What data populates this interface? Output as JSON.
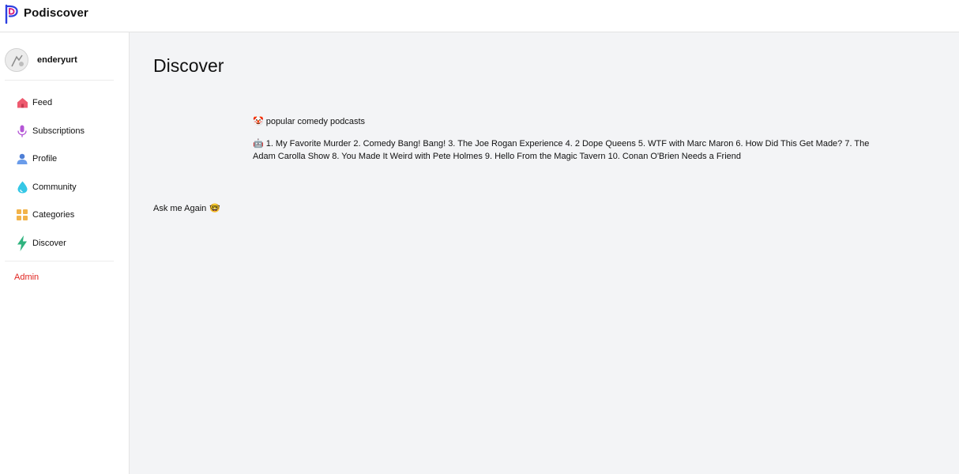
{
  "app": {
    "brand": "Podiscover",
    "colors": {
      "brand_blue": "#2c3fe0",
      "brand_magenta": "#d81b7a",
      "admin_red": "#e0241f",
      "main_bg": "#f3f4f6"
    }
  },
  "user": {
    "username": "enderyurt",
    "avatar_icon": "user-avatar"
  },
  "sidebar": {
    "items": [
      {
        "label": "Feed",
        "icon": "home-icon"
      },
      {
        "label": "Subscriptions",
        "icon": "microphone-icon"
      },
      {
        "label": "Profile",
        "icon": "person-icon"
      },
      {
        "label": "Community",
        "icon": "droplet-icon"
      },
      {
        "label": "Categories",
        "icon": "grid-icon"
      },
      {
        "label": "Discover",
        "icon": "lightning-icon"
      }
    ],
    "admin_label": "Admin"
  },
  "main": {
    "title": "Discover",
    "prompt_emoji": "🤡",
    "prompt_text": "popular comedy podcasts",
    "answer_emoji": "🤖",
    "answer_text": "1. My Favorite Murder 2. Comedy Bang! Bang! 3. The Joe Rogan Experience 4. 2 Dope Queens 5. WTF with Marc Maron 6. How Did This Get Made? 7. The Adam Carolla Show 8. You Made It Weird with Pete Holmes 9. Hello From the Magic Tavern 10. Conan O'Brien Needs a Friend",
    "ask_again_label": "Ask me Again",
    "ask_again_emoji": "🤓"
  }
}
